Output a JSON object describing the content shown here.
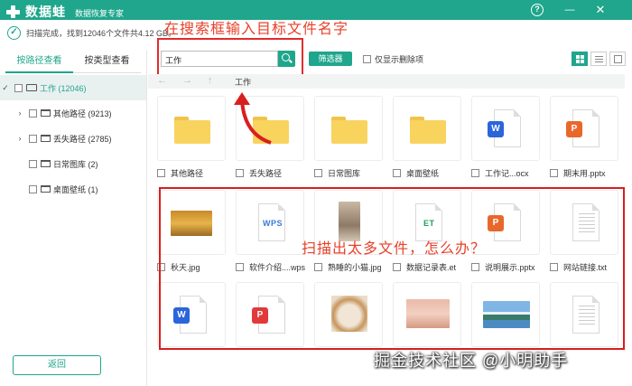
{
  "titlebar": {
    "app_name": "数据蛙",
    "app_subtitle": "数据恢复专家",
    "help": "?",
    "minimize": "—",
    "close": "✕"
  },
  "status": {
    "text": "扫描完成，找到12046个文件共4.12 GB。"
  },
  "annotations": {
    "top": "在搜索框输入目标文件名字",
    "middle": "扫描出太多文件，怎么办？",
    "watermark": "掘金技术社区 @小明助手"
  },
  "sidebar": {
    "tabs": [
      {
        "label": "按路径查看",
        "active": true
      },
      {
        "label": "按类型查看",
        "active": false
      }
    ],
    "tree": [
      {
        "label": "工作 (12046)",
        "expanded": true,
        "root": true
      },
      {
        "label": "其他路径 (9213)",
        "expandable": true
      },
      {
        "label": "丢失路径 (2785)",
        "expandable": true
      },
      {
        "label": "日常图库 (2)",
        "expandable": false
      },
      {
        "label": "桌面壁纸 (1)",
        "expandable": false
      }
    ],
    "back_label": "返回"
  },
  "toolbar": {
    "search_value": "工作",
    "filter_label": "筛选器",
    "show_deleted_label": "仅显示删除项"
  },
  "nav": {
    "breadcrumb": "工作",
    "back": "←",
    "forward": "→",
    "up": "↑"
  },
  "files": [
    {
      "name": "其他路径",
      "icon": "folder"
    },
    {
      "name": "丢失路径",
      "icon": "folder"
    },
    {
      "name": "日常图库",
      "icon": "folder"
    },
    {
      "name": "桌面壁纸",
      "icon": "folder"
    },
    {
      "name": "工作记...ocx",
      "icon": "word",
      "badge": "W"
    },
    {
      "name": "期末用.pptx",
      "icon": "ppt",
      "badge": "P"
    },
    {
      "name": "秋天.jpg",
      "icon": "photo-autumn"
    },
    {
      "name": "软件介绍....wps",
      "icon": "wps",
      "badge": "WPS"
    },
    {
      "name": "熟睡的小猫.jpg",
      "icon": "photo-cat"
    },
    {
      "name": "数据记录表.et",
      "icon": "et",
      "badge": "ET"
    },
    {
      "name": "说明展示.pptx",
      "icon": "ppt",
      "badge": "P"
    },
    {
      "name": "网站链接.txt",
      "icon": "txt"
    },
    {
      "name": "",
      "icon": "word",
      "badge": "W"
    },
    {
      "name": "",
      "icon": "pdf",
      "badge": "P"
    },
    {
      "name": "",
      "icon": "photo-cat2"
    },
    {
      "name": "",
      "icon": "photo-rabbit"
    },
    {
      "name": "",
      "icon": "photo-lake"
    },
    {
      "name": "",
      "icon": "txt"
    }
  ],
  "colors": {
    "brand": "#1fa68c",
    "annotation": "#e8402a"
  }
}
